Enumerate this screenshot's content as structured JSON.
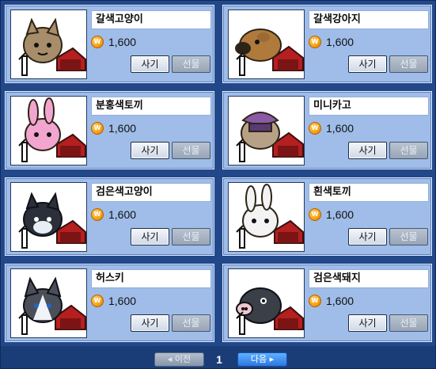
{
  "items": [
    {
      "name": "갈색고양이",
      "price": "1,600",
      "buy_label": "사기",
      "gift_label": "선물",
      "icon": "brown-cat-icon",
      "animal_color": "#a88d6a"
    },
    {
      "name": "갈색강아지",
      "price": "1,600",
      "buy_label": "사기",
      "gift_label": "선물",
      "icon": "brown-dog-icon",
      "animal_color": "#b07a3c"
    },
    {
      "name": "분홍색토끼",
      "price": "1,600",
      "buy_label": "사기",
      "gift_label": "선물",
      "icon": "pink-rabbit-icon",
      "animal_color": "#f2a6cf"
    },
    {
      "name": "미니카고",
      "price": "1,600",
      "buy_label": "사기",
      "gift_label": "선물",
      "icon": "mini-kargo-icon",
      "animal_color": "#8a5aa6"
    },
    {
      "name": "검은색고양이",
      "price": "1,600",
      "buy_label": "사기",
      "gift_label": "선물",
      "icon": "black-cat-icon",
      "animal_color": "#2a2f3a"
    },
    {
      "name": "흰색토끼",
      "price": "1,600",
      "buy_label": "사기",
      "gift_label": "선물",
      "icon": "white-rabbit-icon",
      "animal_color": "#f3f3f3"
    },
    {
      "name": "허스키",
      "price": "1,600",
      "buy_label": "사기",
      "gift_label": "선물",
      "icon": "husky-icon",
      "animal_color": "#4a4f5a"
    },
    {
      "name": "검은색돼지",
      "price": "1,600",
      "buy_label": "사기",
      "gift_label": "선물",
      "icon": "black-pig-icon",
      "animal_color": "#3b3f48"
    }
  ],
  "pagination": {
    "prev_label": "◂ 이전",
    "page": "1",
    "next_label": "다음 ▸"
  },
  "colors": {
    "panel_bg": "#23488a",
    "card_bg": "#9fbde8",
    "coin": "#f6a416",
    "next_button": "#2b78e2"
  }
}
